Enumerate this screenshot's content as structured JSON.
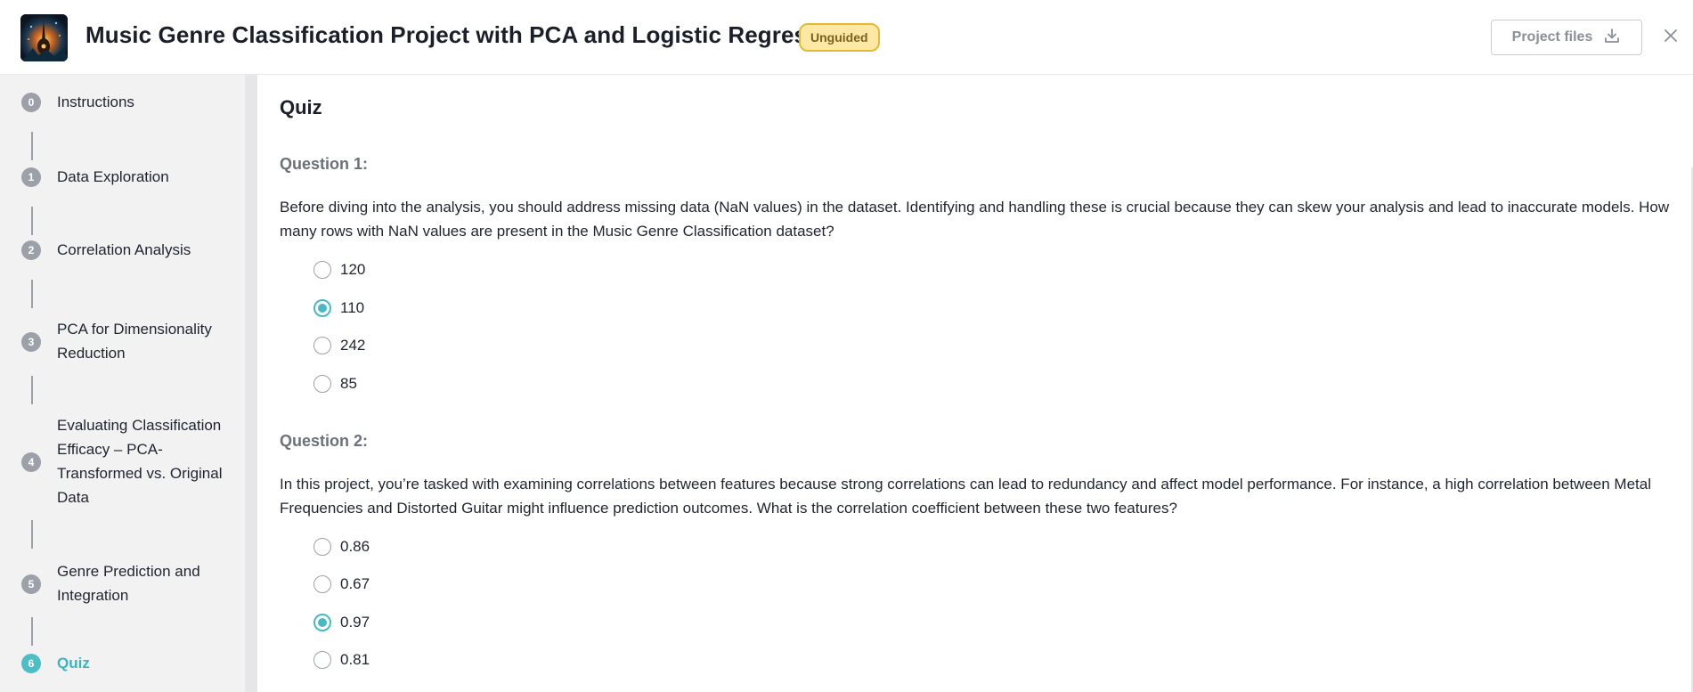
{
  "header": {
    "title": "Music Genre Classification Project with PCA and Logistic Regression",
    "badge": "Unguided",
    "project_files_label": "Project files",
    "logo_icon": "guitar-art-thumbnail",
    "download_icon": "download-icon",
    "close_icon": "close-icon"
  },
  "sidebar": {
    "steps": [
      {
        "num": "0",
        "label": "Instructions"
      },
      {
        "num": "1",
        "label": "Data Exploration"
      },
      {
        "num": "2",
        "label": "Correlation Analysis"
      },
      {
        "num": "3",
        "label": "PCA for Dimensionality Reduction"
      },
      {
        "num": "4",
        "label": "Evaluating Classification Efficacy – PCA-Transformed vs. Original Data"
      },
      {
        "num": "5",
        "label": "Genre Prediction and Integration"
      },
      {
        "num": "6",
        "label": "Quiz"
      }
    ],
    "active_step": "6"
  },
  "main": {
    "title": "Quiz",
    "questions": [
      {
        "heading": "Question 1:",
        "text": "Before diving into the analysis, you should address missing data (NaN values) in the dataset. Identifying and handling these is crucial because they can skew your analysis and lead to inaccurate models. How many rows with NaN values are present in the Music Genre Classification dataset?",
        "options": [
          "120",
          "110",
          "242",
          "85"
        ],
        "selected": "110"
      },
      {
        "heading": "Question 2:",
        "text": "In this project, you’re tasked with examining correlations between features because strong correlations can lead to redundancy and affect model performance. For instance, a high correlation between Metal Frequencies and Distorted Guitar might influence prediction outcomes. What is the correlation coefficient between these two features?",
        "options": [
          "0.86",
          "0.67",
          "0.97",
          "0.81"
        ],
        "selected": "0.97"
      }
    ]
  },
  "colors": {
    "accent": "#47b9c2",
    "badge_bg": "#fde9a3",
    "badge_border": "#e3b93a",
    "sidebar_bg": "#f2f2f3"
  }
}
